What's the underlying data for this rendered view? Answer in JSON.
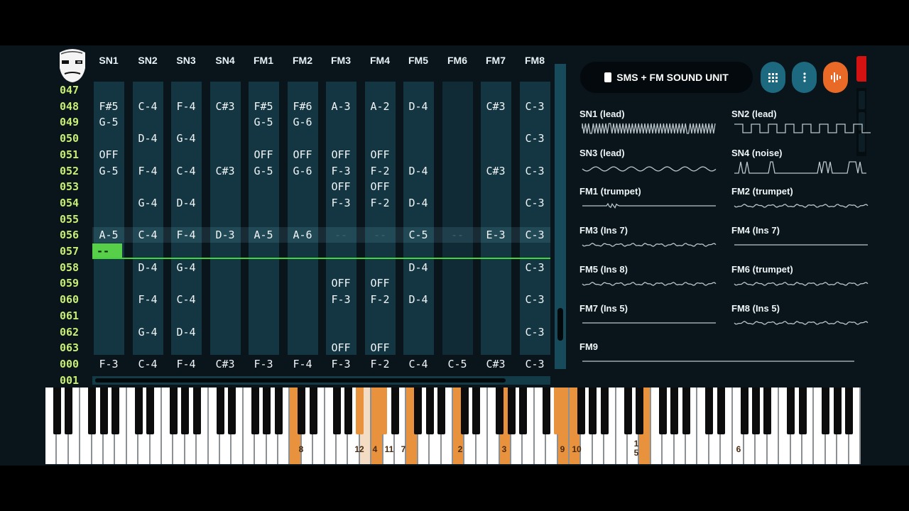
{
  "channels": [
    "SN1",
    "SN2",
    "SN3",
    "SN4",
    "FM1",
    "FM2",
    "FM3",
    "FM4",
    "FM5",
    "FM6",
    "FM7",
    "FM8"
  ],
  "rows": [
    {
      "num": "047",
      "cells": [
        "",
        "",
        "",
        "",
        "",
        "",
        "",
        "",
        "",
        "",
        "",
        ""
      ]
    },
    {
      "num": "048",
      "cells": [
        "F#5",
        "C-4",
        "F-4",
        "C#3",
        "F#5",
        "F#6",
        "A-3",
        "A-2",
        "D-4",
        "",
        "C#3",
        "C-3"
      ]
    },
    {
      "num": "049",
      "cells": [
        "G-5",
        "",
        "",
        "",
        "G-5",
        "G-6",
        "",
        "",
        "",
        "",
        "",
        ""
      ]
    },
    {
      "num": "050",
      "cells": [
        "",
        "D-4",
        "G-4",
        "",
        "",
        "",
        "",
        "",
        "",
        "",
        "",
        "C-3"
      ]
    },
    {
      "num": "051",
      "cells": [
        "OFF",
        "",
        "",
        "",
        "OFF",
        "OFF",
        "OFF",
        "OFF",
        "",
        "",
        "",
        ""
      ]
    },
    {
      "num": "052",
      "cells": [
        "G-5",
        "F-4",
        "C-4",
        "C#3",
        "G-5",
        "G-6",
        "F-3",
        "F-2",
        "D-4",
        "",
        "C#3",
        "C-3"
      ]
    },
    {
      "num": "053",
      "cells": [
        "",
        "",
        "",
        "",
        "",
        "",
        "OFF",
        "OFF",
        "",
        "",
        "",
        ""
      ]
    },
    {
      "num": "054",
      "cells": [
        "",
        "G-4",
        "D-4",
        "",
        "",
        "",
        "F-3",
        "F-2",
        "D-4",
        "",
        "",
        "C-3"
      ]
    },
    {
      "num": "055",
      "cells": [
        "",
        "",
        "",
        "",
        "",
        "",
        "",
        "",
        "",
        "",
        "",
        ""
      ]
    },
    {
      "num": "056",
      "cells": [
        "A-5",
        "C-4",
        "F-4",
        "D-3",
        "A-5",
        "A-6",
        "--",
        "--",
        "C-5",
        "--",
        "E-3",
        "C-3"
      ]
    },
    {
      "num": "057",
      "cells": [
        "--",
        "",
        "",
        "",
        "",
        "",
        "",
        "",
        "",
        "",
        "",
        ""
      ]
    },
    {
      "num": "058",
      "cells": [
        "",
        "D-4",
        "G-4",
        "",
        "",
        "",
        "",
        "",
        "D-4",
        "",
        "",
        "C-3"
      ]
    },
    {
      "num": "059",
      "cells": [
        "",
        "",
        "",
        "",
        "",
        "",
        "OFF",
        "OFF",
        "",
        "",
        "",
        ""
      ]
    },
    {
      "num": "060",
      "cells": [
        "",
        "F-4",
        "C-4",
        "",
        "",
        "",
        "F-3",
        "F-2",
        "D-4",
        "",
        "",
        "C-3"
      ]
    },
    {
      "num": "061",
      "cells": [
        "",
        "",
        "",
        "",
        "",
        "",
        "",
        "",
        "",
        "",
        "",
        ""
      ]
    },
    {
      "num": "062",
      "cells": [
        "",
        "G-4",
        "D-4",
        "",
        "",
        "",
        "",
        "",
        "",
        "",
        "",
        "C-3"
      ]
    },
    {
      "num": "063",
      "cells": [
        "",
        "",
        "",
        "",
        "",
        "",
        "OFF",
        "OFF",
        "",
        "",
        "",
        ""
      ]
    },
    {
      "num": "000",
      "cells": [
        "F-3",
        "C-4",
        "F-4",
        "C#3",
        "F-3",
        "F-4",
        "F-3",
        "F-2",
        "C-4",
        "C-5",
        "C#3",
        "C-3"
      ]
    },
    {
      "num": "001",
      "cells": [
        "",
        "",
        "",
        "",
        "",
        "",
        "",
        "",
        "",
        "",
        "",
        ""
      ]
    }
  ],
  "cursor": {
    "row_index": 10,
    "channel_index": 0
  },
  "header": {
    "unit_label": "SMS + FM SOUND UNIT"
  },
  "buttons": {
    "grid_icon": "grid-icon",
    "menu_icon": "more-vertical-icon",
    "wave_icon": "waveform-icon"
  },
  "instruments": [
    {
      "label": "SN1 (lead)",
      "wave": "dense"
    },
    {
      "label": "SN2 (lead)",
      "wave": "square"
    },
    {
      "label": "SN3 (lead)",
      "wave": "ripple"
    },
    {
      "label": "SN4 (noise)",
      "wave": "noise"
    },
    {
      "label": "FM1 (trumpet)",
      "wave": "flat-bump"
    },
    {
      "label": "FM2 (trumpet)",
      "wave": "flat-wobble"
    },
    {
      "label": "FM3 (Ins 7)",
      "wave": "flat-wobble"
    },
    {
      "label": "FM4 (Ins 7)",
      "wave": "flat"
    },
    {
      "label": "FM5 (Ins 8)",
      "wave": "flat-wobble"
    },
    {
      "label": "FM6 (trumpet)",
      "wave": "flat-wobble"
    },
    {
      "label": "FM7 (Ins 5)",
      "wave": "flat"
    },
    {
      "label": "FM8 (Ins 5)",
      "wave": "flat-wobble"
    },
    {
      "label": "FM9",
      "wave": "flat"
    }
  ],
  "piano_key_labels": [
    "8",
    "12",
    "4",
    "11",
    "7",
    "2",
    "3",
    "9",
    "10",
    "1 5",
    "6"
  ],
  "colors": {
    "accent_green": "#58cf48",
    "highlight_orange": "#e8923d",
    "panel_bg": "#09141b",
    "channel_bg": "#133642",
    "row_number": "#c8ef74"
  }
}
